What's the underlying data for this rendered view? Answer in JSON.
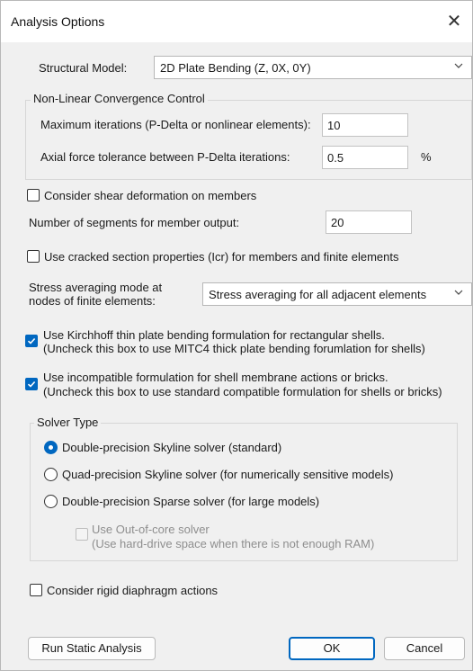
{
  "window": {
    "title": "Analysis Options",
    "close_glyph": "✕"
  },
  "structural_model": {
    "label": "Structural Model:",
    "value": "2D Plate Bending (Z, 0X, 0Y)"
  },
  "convergence": {
    "group_label": "Non-Linear Convergence Control",
    "max_iter_label": "Maximum iterations (P-Delta or nonlinear elements):",
    "max_iter_value": "10",
    "axial_tol_label": "Axial force tolerance between P-Delta iterations:",
    "axial_tol_value": "0.5",
    "axial_tol_unit": "%"
  },
  "shear_deformation": {
    "label": "Consider shear deformation on members",
    "checked": false
  },
  "segments": {
    "label": "Number of segments for member output:",
    "value": "20"
  },
  "cracked": {
    "label": "Use cracked section properties (Icr) for members and finite elements",
    "checked": false
  },
  "stress_avg": {
    "label_line1": "Stress averaging mode at",
    "label_line2": "nodes of finite elements:",
    "value": "Stress averaging for all adjacent elements"
  },
  "kirchhoff": {
    "line1": "Use Kirchhoff thin plate bending formulation for rectangular shells.",
    "line2": "(Uncheck this box to use MITC4 thick plate bending forumlation for shells)",
    "checked": true
  },
  "incompatible": {
    "line1": "Use incompatible formulation for shell membrane actions or bricks.",
    "line2": "(Uncheck this box to use standard compatible formulation for shells or bricks)",
    "checked": true
  },
  "solver": {
    "group_label": "Solver Type",
    "options": [
      {
        "label": "Double-precision Skyline solver (standard)",
        "selected": true
      },
      {
        "label": "Quad-precision Skyline solver (for numerically sensitive models)",
        "selected": false
      },
      {
        "label": "Double-precision Sparse solver (for large models)",
        "selected": false
      }
    ],
    "out_of_core_line1": "Use Out-of-core solver",
    "out_of_core_line2": "(Use hard-drive space when there is not enough RAM)"
  },
  "rigid_diaphragm": {
    "label": "Consider rigid diaphragm actions",
    "checked": false
  },
  "buttons": {
    "run": "Run Static Analysis",
    "ok": "OK",
    "cancel": "Cancel"
  },
  "colors": {
    "accent": "#0067c0",
    "dialog_bg": "#f0f0f0",
    "titlebar_bg": "#ffffff",
    "disabled_text": "#8e8e8e"
  },
  "icons": {
    "checkmark": "checkmark-icon",
    "chevron": "chevron-down-icon",
    "close": "close-icon"
  }
}
